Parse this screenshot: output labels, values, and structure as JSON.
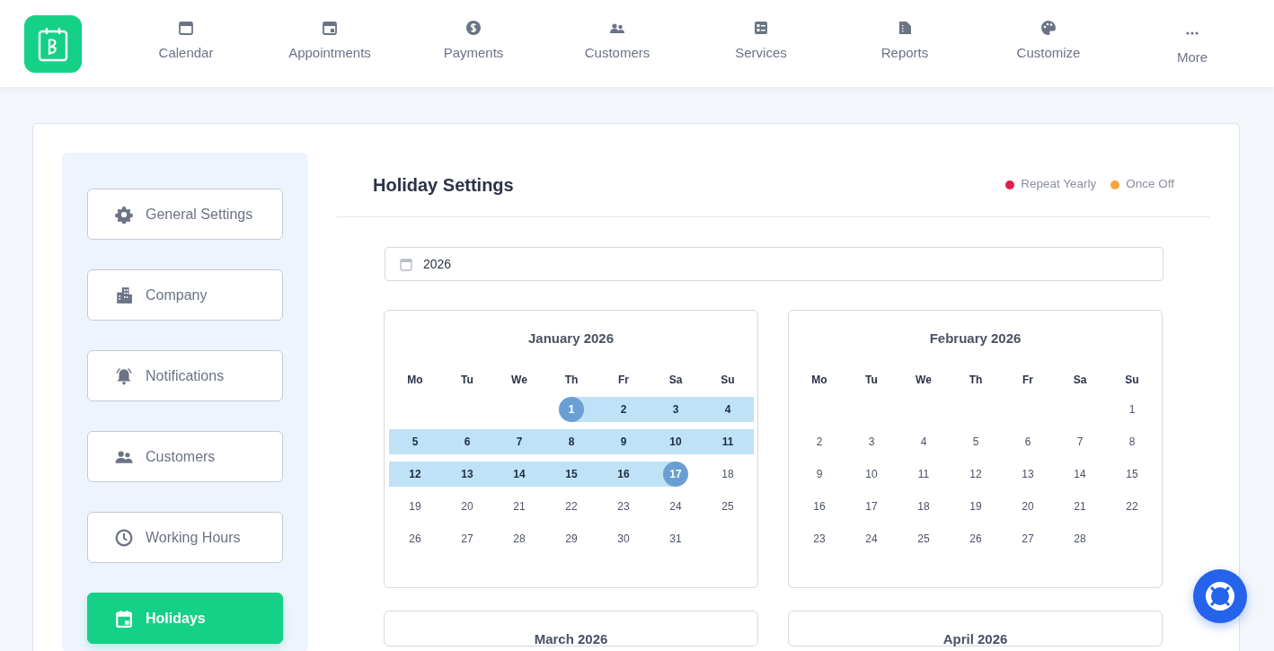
{
  "nav": [
    {
      "label": "Calendar"
    },
    {
      "label": "Appointments"
    },
    {
      "label": "Payments"
    },
    {
      "label": "Customers"
    },
    {
      "label": "Services"
    },
    {
      "label": "Reports"
    },
    {
      "label": "Customize"
    },
    {
      "label": "More"
    }
  ],
  "sidebar": {
    "items": [
      {
        "label": "General Settings",
        "selected": false
      },
      {
        "label": "Company",
        "selected": false
      },
      {
        "label": "Notifications",
        "selected": false
      },
      {
        "label": "Customers",
        "selected": false
      },
      {
        "label": "Working Hours",
        "selected": false
      },
      {
        "label": "Holidays",
        "selected": true
      }
    ]
  },
  "page_title": "Holiday Settings",
  "legend": [
    {
      "label": "Repeat Yearly",
      "color": "#e11d48"
    },
    {
      "label": "Once Off",
      "color": "#f4a63a"
    }
  ],
  "year_field": {
    "value": "2026"
  },
  "calendars": [
    {
      "title": "January 2026",
      "weekdays": [
        "Mo",
        "Tu",
        "We",
        "Th",
        "Fr",
        "Sa",
        "Su"
      ],
      "weeks": [
        {
          "starts_midweek": true,
          "days": [
            {
              "d": "1",
              "selected": true,
              "endpoint": true
            },
            {
              "d": "2",
              "selected": true,
              "endpoint": false
            },
            {
              "d": "3",
              "selected": true,
              "endpoint": false
            },
            {
              "d": "4",
              "selected": true,
              "endpoint": false
            }
          ]
        },
        {
          "starts_midweek": false,
          "days": [
            {
              "d": "5",
              "selected": true,
              "endpoint": false
            },
            {
              "d": "6",
              "selected": true,
              "endpoint": false
            },
            {
              "d": "7",
              "selected": true,
              "endpoint": false
            },
            {
              "d": "8",
              "selected": true,
              "endpoint": false
            },
            {
              "d": "9",
              "selected": true,
              "endpoint": false
            },
            {
              "d": "10",
              "selected": true,
              "endpoint": false
            },
            {
              "d": "11",
              "selected": true,
              "endpoint": false
            }
          ]
        },
        {
          "starts_midweek": false,
          "days": [
            {
              "d": "12",
              "selected": true,
              "endpoint": false
            },
            {
              "d": "13",
              "selected": true,
              "endpoint": false
            },
            {
              "d": "14",
              "selected": true,
              "endpoint": false
            },
            {
              "d": "15",
              "selected": true,
              "endpoint": false
            },
            {
              "d": "16",
              "selected": true,
              "endpoint": false
            },
            {
              "d": "17",
              "selected": true,
              "endpoint": true
            },
            {
              "d": "18",
              "selected": false,
              "endpoint": false
            }
          ]
        },
        {
          "starts_midweek": false,
          "days": [
            {
              "d": "19",
              "selected": false,
              "endpoint": false
            },
            {
              "d": "20",
              "selected": false,
              "endpoint": false
            },
            {
              "d": "21",
              "selected": false,
              "endpoint": false
            },
            {
              "d": "22",
              "selected": false,
              "endpoint": false
            },
            {
              "d": "23",
              "selected": false,
              "endpoint": false
            },
            {
              "d": "24",
              "selected": false,
              "endpoint": false
            },
            {
              "d": "25",
              "selected": false,
              "endpoint": false
            }
          ]
        },
        {
          "starts_midweek": false,
          "days": [
            {
              "d": "26",
              "selected": false,
              "endpoint": false
            },
            {
              "d": "27",
              "selected": false,
              "endpoint": false
            },
            {
              "d": "28",
              "selected": false,
              "endpoint": false
            },
            {
              "d": "29",
              "selected": false,
              "endpoint": false
            },
            {
              "d": "30",
              "selected": false,
              "endpoint": false
            },
            {
              "d": "31",
              "selected": false,
              "endpoint": false
            }
          ]
        }
      ]
    },
    {
      "title": "February 2026",
      "weekdays": [
        "Mo",
        "Tu",
        "We",
        "Th",
        "Fr",
        "Sa",
        "Su"
      ],
      "weeks": [
        {
          "starts_midweek": true,
          "days": [
            {
              "d": "1",
              "selected": false,
              "endpoint": false
            }
          ]
        },
        {
          "starts_midweek": false,
          "days": [
            {
              "d": "2",
              "selected": false,
              "endpoint": false
            },
            {
              "d": "3",
              "selected": false,
              "endpoint": false
            },
            {
              "d": "4",
              "selected": false,
              "endpoint": false
            },
            {
              "d": "5",
              "selected": false,
              "endpoint": false
            },
            {
              "d": "6",
              "selected": false,
              "endpoint": false
            },
            {
              "d": "7",
              "selected": false,
              "endpoint": false
            },
            {
              "d": "8",
              "selected": false,
              "endpoint": false
            }
          ]
        },
        {
          "starts_midweek": false,
          "days": [
            {
              "d": "9",
              "selected": false,
              "endpoint": false
            },
            {
              "d": "10",
              "selected": false,
              "endpoint": false
            },
            {
              "d": "11",
              "selected": false,
              "endpoint": false
            },
            {
              "d": "12",
              "selected": false,
              "endpoint": false
            },
            {
              "d": "13",
              "selected": false,
              "endpoint": false
            },
            {
              "d": "14",
              "selected": false,
              "endpoint": false
            },
            {
              "d": "15",
              "selected": false,
              "endpoint": false
            }
          ]
        },
        {
          "starts_midweek": false,
          "days": [
            {
              "d": "16",
              "selected": false,
              "endpoint": false
            },
            {
              "d": "17",
              "selected": false,
              "endpoint": false
            },
            {
              "d": "18",
              "selected": false,
              "endpoint": false
            },
            {
              "d": "19",
              "selected": false,
              "endpoint": false
            },
            {
              "d": "20",
              "selected": false,
              "endpoint": false
            },
            {
              "d": "21",
              "selected": false,
              "endpoint": false
            },
            {
              "d": "22",
              "selected": false,
              "endpoint": false
            }
          ]
        },
        {
          "starts_midweek": false,
          "days": [
            {
              "d": "23",
              "selected": false,
              "endpoint": false
            },
            {
              "d": "24",
              "selected": false,
              "endpoint": false
            },
            {
              "d": "25",
              "selected": false,
              "endpoint": false
            },
            {
              "d": "26",
              "selected": false,
              "endpoint": false
            },
            {
              "d": "27",
              "selected": false,
              "endpoint": false
            },
            {
              "d": "28",
              "selected": false,
              "endpoint": false
            }
          ]
        }
      ]
    },
    {
      "title": "March 2026"
    },
    {
      "title": "April 2026"
    }
  ]
}
